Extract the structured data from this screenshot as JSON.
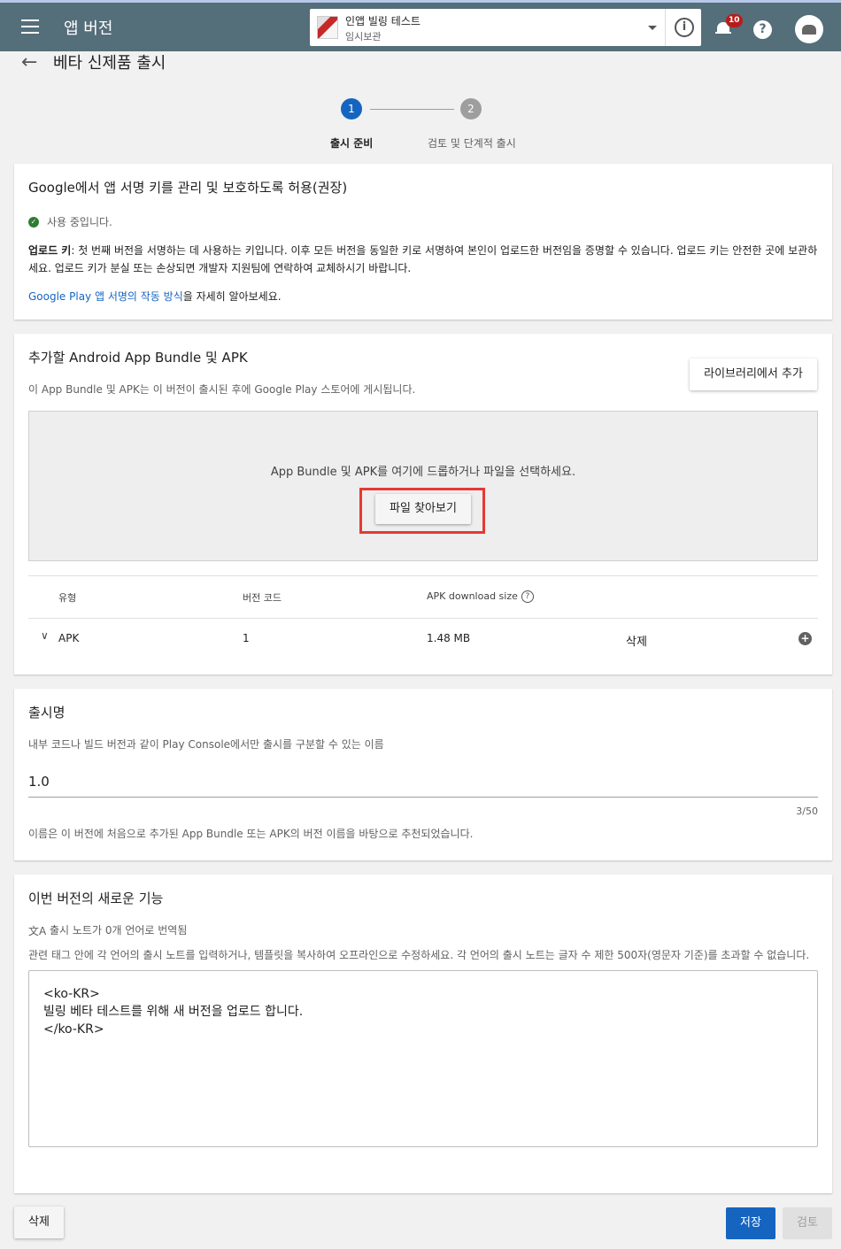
{
  "header": {
    "title": "앱 버전",
    "app_name": "인앱 빌링 테스트",
    "app_status": "임시보관",
    "notification_count": "10",
    "info_glyph": "i",
    "help_glyph": "?"
  },
  "page": {
    "title": "베타 신제품 출시",
    "back_glyph": "←"
  },
  "stepper": {
    "steps": [
      {
        "number": "1",
        "label": "출시 준비"
      },
      {
        "number": "2",
        "label": "검토 및 단계적 출시"
      }
    ]
  },
  "signing": {
    "title": "Google에서 앱 서명 키를 관리 및 보호하도록 허용(권장)",
    "status": "사용 중입니다.",
    "upload_key_label": "업로드 키",
    "upload_key_text": ": 첫 번째 버전을 서명하는 데 사용하는 키입니다. 이후 모든 버전을 동일한 키로 서명하여 본인이 업로드한 버전임을 증명할 수 있습니다. 업로드 키는 안전한 곳에 보관하세요. 업로드 키가 분실 또는 손상되면 개발자 지원팀에 연락하여 교체하시기 바랍니다.",
    "learn_link": "Google Play 앱 서명의 작동 방식",
    "learn_suffix": "을 자세히 알아보세요."
  },
  "bundles": {
    "title": "추가할 Android App Bundle 및 APK",
    "description": "이 App Bundle 및 APK는 이 버전이 출시된 후에 Google Play 스토어에 게시됩니다.",
    "add_from_library": "라이브러리에서 추가",
    "drop_text": "App Bundle 및 APK를 여기에 드롭하거나 파일을 선택하세요.",
    "browse_button": "파일 찾아보기",
    "table": {
      "headers": {
        "type": "유형",
        "version_code": "버전 코드",
        "size": "APK download size"
      },
      "row": {
        "type": "APK",
        "version_code": "1",
        "size": "1.48 MB",
        "delete": "삭제"
      }
    }
  },
  "release_name": {
    "title": "출시명",
    "description": "내부 코드나 빌드 버전과 같이 Play Console에서만 출시를 구분할 수 있는 이름",
    "value": "1.0",
    "counter": "3/50",
    "hint": "이름은 이 버전에 처음으로 추가된 App Bundle 또는 APK의 버전 이름을 바탕으로 추천되었습니다."
  },
  "whats_new": {
    "title": "이번 버전의 새로운 기능",
    "translation_status": "출시 노트가 0개 언어로 번역됨",
    "description": "관련 태그 안에 각 언어의 출시 노트를 입력하거나, 템플릿을 복사하여 오프라인으로 수정하세요. 각 언어의 출시 노트는 글자 수 제한 500자(영문자 기준)를 초과할 수 없습니다.",
    "notes": "<ko-KR>\n빌링 베타 테스트를 위해 새 버전을 업로드 합니다.\n</ko-KR>"
  },
  "footer": {
    "delete": "삭제",
    "save": "저장",
    "review": "검토"
  }
}
